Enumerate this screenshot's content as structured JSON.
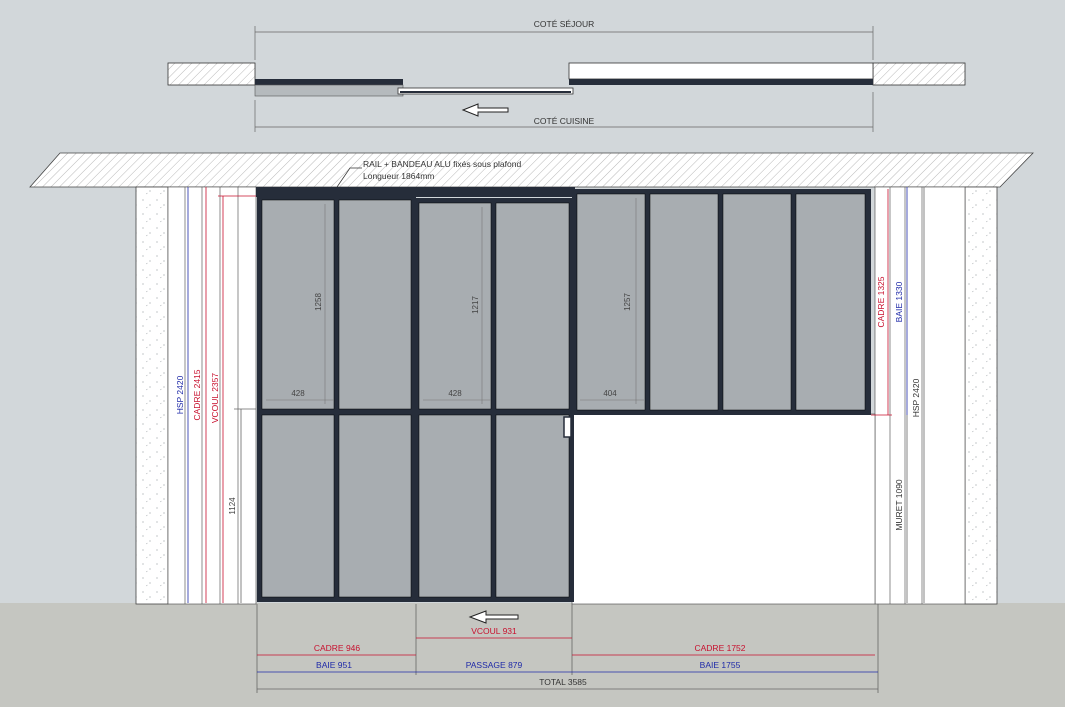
{
  "colors": {
    "background": "#d2d7da",
    "floor": "#c5c6c1",
    "wall_hatch": "#ffffff",
    "frame": "#262d3a",
    "glass": "#a8adb1",
    "red_dimension": "#c8102e",
    "blue_dimension": "#1f2aa8",
    "gray_dimension": "#666666"
  },
  "plan_view": {
    "top_label": "COTÉ SÉJOUR",
    "bottom_label": "COTÉ CUISINE"
  },
  "ceiling_note": {
    "line1": "RAIL + BANDEAU ALU  fixés sous plafond",
    "line2": "Longueur 1864mm"
  },
  "left_dimensions": {
    "hsp": "HSP 2420",
    "cadre": "CADRE 2415",
    "vcoul": "VCOUL 2357",
    "bottom_panel": "1124"
  },
  "right_dimensions": {
    "cadre": "CADRE 1325",
    "baie": "BAIE 1330",
    "hsp": "HSP 2420",
    "muret": "MURET 1090"
  },
  "pane_dimensions": {
    "fixed_height": "1258",
    "fixed_width": "428",
    "sliding_height": "1217",
    "sliding_width": "428",
    "right_height": "1257",
    "right_width": "404"
  },
  "bottom_dimensions": {
    "cadre_left": "CADRE 946",
    "vcoul": "VCOUL 931",
    "cadre_right": "CADRE 1752",
    "baie_left": "BAIE 951",
    "passage": "PASSAGE 879",
    "baie_right": "BAIE 1755",
    "total": "TOTAL 3585"
  }
}
